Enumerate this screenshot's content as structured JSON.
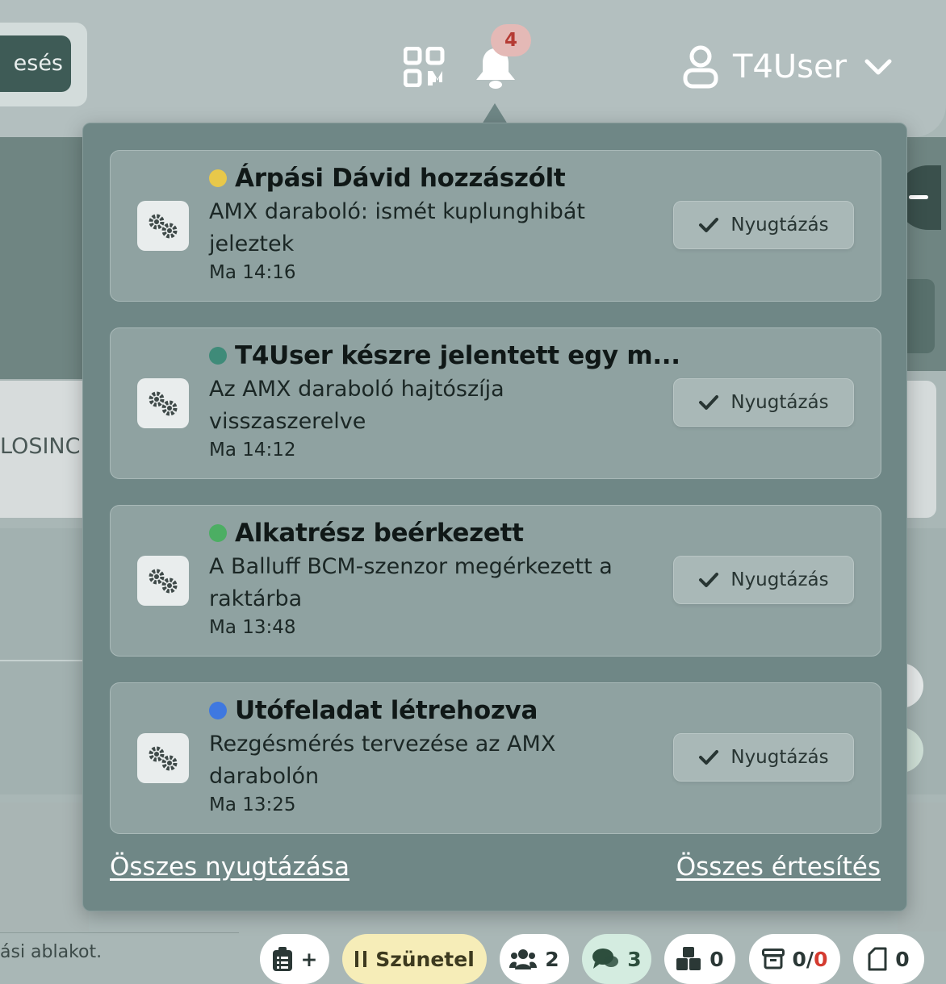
{
  "header": {
    "left_button_label": "esés",
    "notification_count": "4",
    "user_name": "T4User"
  },
  "background": {
    "card_label": "LOSINC",
    "footer_text": "ási ablakot."
  },
  "footer_pills": {
    "tasks_plus": "+",
    "pause_label": "Szünetel",
    "people_count": "2",
    "chats_count": "3",
    "parts_count": "0",
    "archive_count": "0",
    "archive_total": "0",
    "archive_separator": "/",
    "docs_count": "0"
  },
  "notifications": {
    "items": [
      {
        "title": "Árpási Dávid hozzászólt",
        "body": "AMX daraboló: ismét kuplunghibát jeleztek",
        "time": "Ma 14:16",
        "dot_color": "#e8c84a",
        "icon": "gears-icon",
        "ack_label": "Nyugtázás"
      },
      {
        "title": "T4User készre jelentett egy m...",
        "body": "Az AMX daraboló hajtószíja visszaszerelve",
        "time": "Ma 14:12",
        "dot_color": "#3f8b79",
        "icon": "gears-icon",
        "ack_label": "Nyugtázás"
      },
      {
        "title": "Alkatrész beérkezett",
        "body": "A Balluff BCM-szenzor megérkezett a raktárba",
        "time": "Ma 13:48",
        "dot_color": "#4cae63",
        "icon": "gears-icon",
        "ack_label": "Nyugtázás"
      },
      {
        "title": "Utófeladat létrehozva",
        "body": "Rezgésmérés tervezése az AMX darabolón",
        "time": "Ma 13:25",
        "dot_color": "#3f78e0",
        "icon": "gears-icon",
        "ack_label": "Nyugtázás"
      }
    ],
    "acknowledge_all": "Összes nyugtázása",
    "all_notifications": "Összes értesítés"
  }
}
